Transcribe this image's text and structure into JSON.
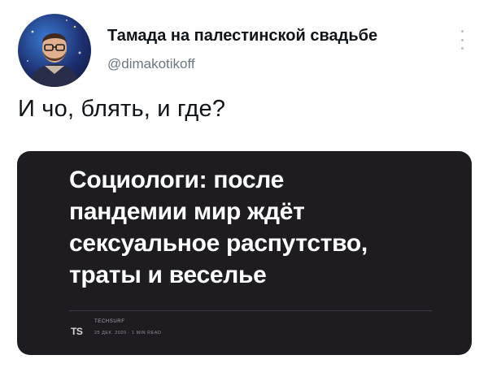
{
  "tweet": {
    "author": {
      "display_name": "Тамада на палестинской свадьбе",
      "handle": "@dimakotikoff",
      "avatar_icon": "user-avatar"
    },
    "more_icon": "more-vertical-icon",
    "text": "И чо, блять, и где?"
  },
  "card": {
    "background": "#1e1c21",
    "headline_lines": [
      "Социологи: после",
      "пандемии мир ждёт",
      "сексуальное распутство,",
      "траты и веселье"
    ],
    "source": {
      "logo": "TS",
      "name": "TECHSURF",
      "meta": "25 ДЕК. 2020  ·  1 MIN READ"
    }
  }
}
